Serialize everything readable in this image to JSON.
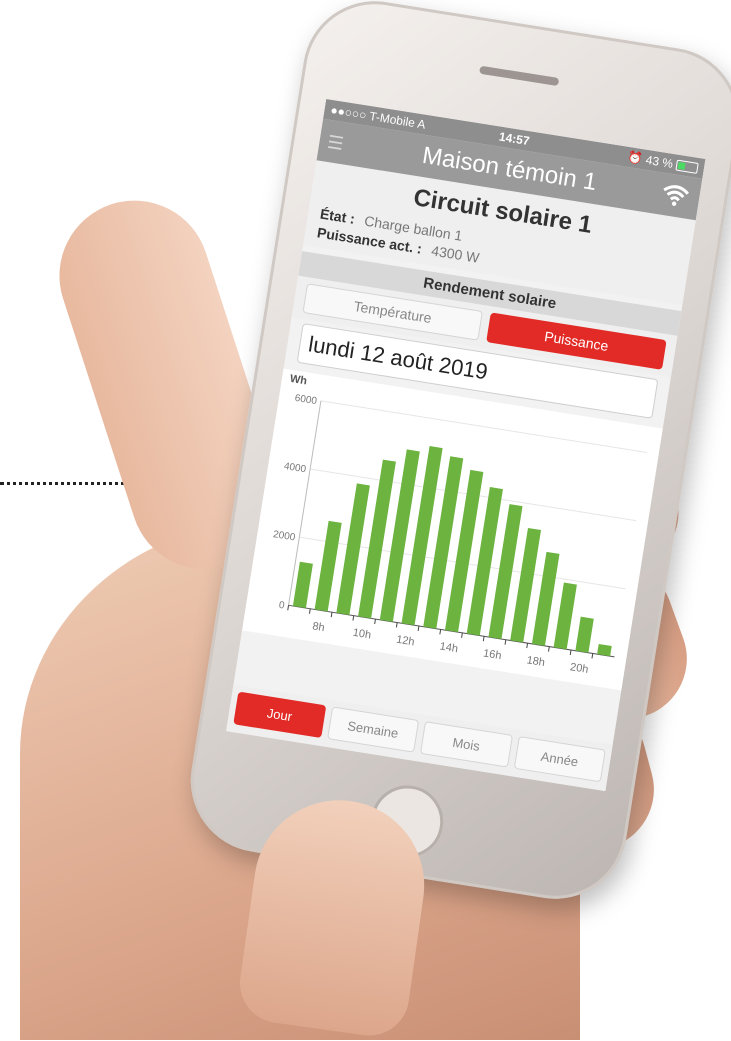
{
  "status_bar": {
    "carrier": "●●○○○ T-Mobile A",
    "time": "14:57",
    "battery": "43 %"
  },
  "nav": {
    "title": "Maison témoin 1"
  },
  "circuit": {
    "title": "Circuit solaire 1",
    "state_label": "État :",
    "state_value": "Charge ballon 1",
    "power_label": "Puissance act. :",
    "power_value": "4300 W"
  },
  "section": {
    "title": "Rendement solaire"
  },
  "segments": [
    {
      "label": "Température",
      "active": false
    },
    {
      "label": "Puissance",
      "active": true
    }
  ],
  "date": "lundi 12 août 2019",
  "tabs": [
    {
      "label": "Jour",
      "active": true
    },
    {
      "label": "Semaine",
      "active": false
    },
    {
      "label": "Mois",
      "active": false
    },
    {
      "label": "Année",
      "active": false
    }
  ],
  "colors": {
    "accent": "#e22b26",
    "bar": "#6cb33f"
  },
  "icons": [
    "menu-icon",
    "wifi-icon",
    "alarm-icon",
    "battery-icon"
  ],
  "chart_data": {
    "type": "bar",
    "ylabel": "Wh",
    "ylim": [
      0,
      6000
    ],
    "yticks": [
      "0",
      "2000",
      "4000",
      "6000"
    ],
    "categories": [
      "7h",
      "8h",
      "9h",
      "10h",
      "11h",
      "12h",
      "13h",
      "14h",
      "15h",
      "16h",
      "17h",
      "18h",
      "19h",
      "20h",
      "21h"
    ],
    "xtick_labels": [
      "8h",
      "10h",
      "12h",
      "14h",
      "16h",
      "18h",
      "20h"
    ],
    "values": [
      1300,
      2600,
      3800,
      4600,
      5000,
      5200,
      5000,
      4700,
      4300,
      3900,
      3300,
      2700,
      1900,
      1000,
      300
    ]
  }
}
